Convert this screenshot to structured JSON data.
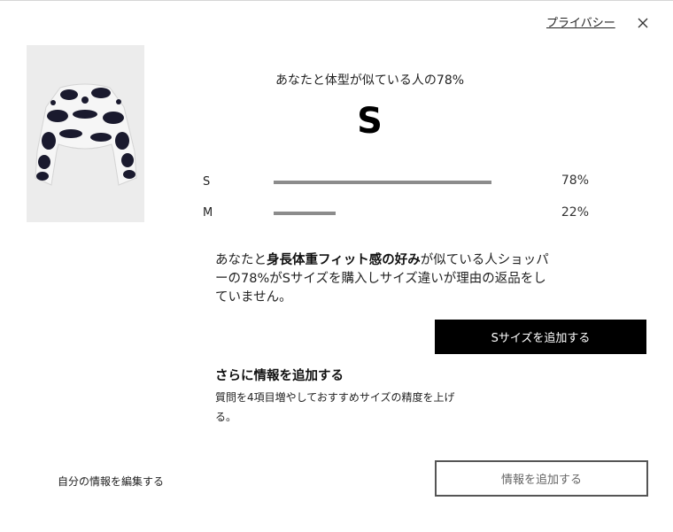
{
  "header": {
    "privacy_label": "プライバシー",
    "close_icon": "close-icon"
  },
  "product": {
    "image_icon": "knit-sweater-image"
  },
  "recommendation": {
    "headline": "あなたと体型が似ている人の78%",
    "size": "S",
    "distribution": [
      {
        "size": "S",
        "percent_label": "78%",
        "fraction": 0.78
      },
      {
        "size": "M",
        "percent_label": "22%",
        "fraction": 0.22
      }
    ]
  },
  "description": {
    "prefix": "あなたと",
    "bold": "身長体重フィット感の好み",
    "suffix": "が似ている人ショッパーの78%がSサイズを購入しサイズ違いが理由の返品をしていません。"
  },
  "add_size_button": "Sサイズを追加する",
  "more_info": {
    "title": "さらに情報を追加する",
    "text": "質問を4項目増やしておすすめサイズの精度を上げる。"
  },
  "footer": {
    "edit_label": "自分の情報を編集する",
    "add_info_button": "情報を追加する"
  },
  "colors": {
    "bar": "#8c8c8c",
    "primary_button_bg": "#000000",
    "outline_button_border": "#555555"
  }
}
